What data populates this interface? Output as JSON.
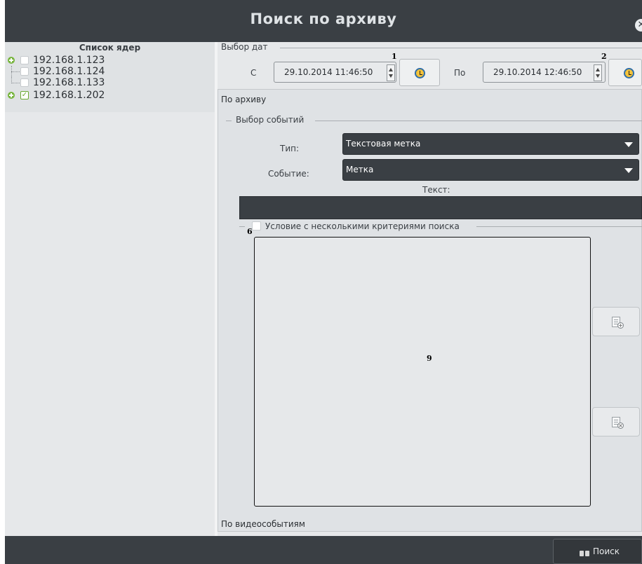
{
  "window": {
    "title": "Поиск по архиву",
    "close_icon": "close-icon"
  },
  "cores": {
    "header": "Список ядер",
    "items": [
      {
        "label": "192.168.1.123",
        "checked": false,
        "expandable": true
      },
      {
        "label": "192.168.1.124",
        "checked": false,
        "expandable": false
      },
      {
        "label": "192.168.1.133",
        "checked": false,
        "expandable": false
      },
      {
        "label": "192.168.1.202",
        "checked": true,
        "expandable": true
      }
    ]
  },
  "date_selection": {
    "group_title": "Выбор дат",
    "from_label": "С",
    "from_value": "29.10.2014 11:46:50",
    "from_marker": "1",
    "to_label": "По",
    "to_value": "29.10.2014 12:46:50",
    "to_marker": "2"
  },
  "tabs": {
    "archive_tab": "По архиву",
    "video_events_tab": "По видеособытиям"
  },
  "event_selection": {
    "group_title": "Выбор событий",
    "type_label": "Тип:",
    "type_value": "Текстовая метка",
    "event_label": "Событие:",
    "event_value": "Метка",
    "text_label": "Текст:",
    "text_value": ""
  },
  "criteria": {
    "checkbox_label": "Условие с несколькими критериями поиска",
    "checked": false,
    "marker": "6",
    "list_marker": "9"
  },
  "bottom": {
    "search_label": "Поиск"
  },
  "colors": {
    "titlebar": "#3a3f44",
    "panel": "#e6e8ea",
    "check_green": "#6aaa32"
  }
}
